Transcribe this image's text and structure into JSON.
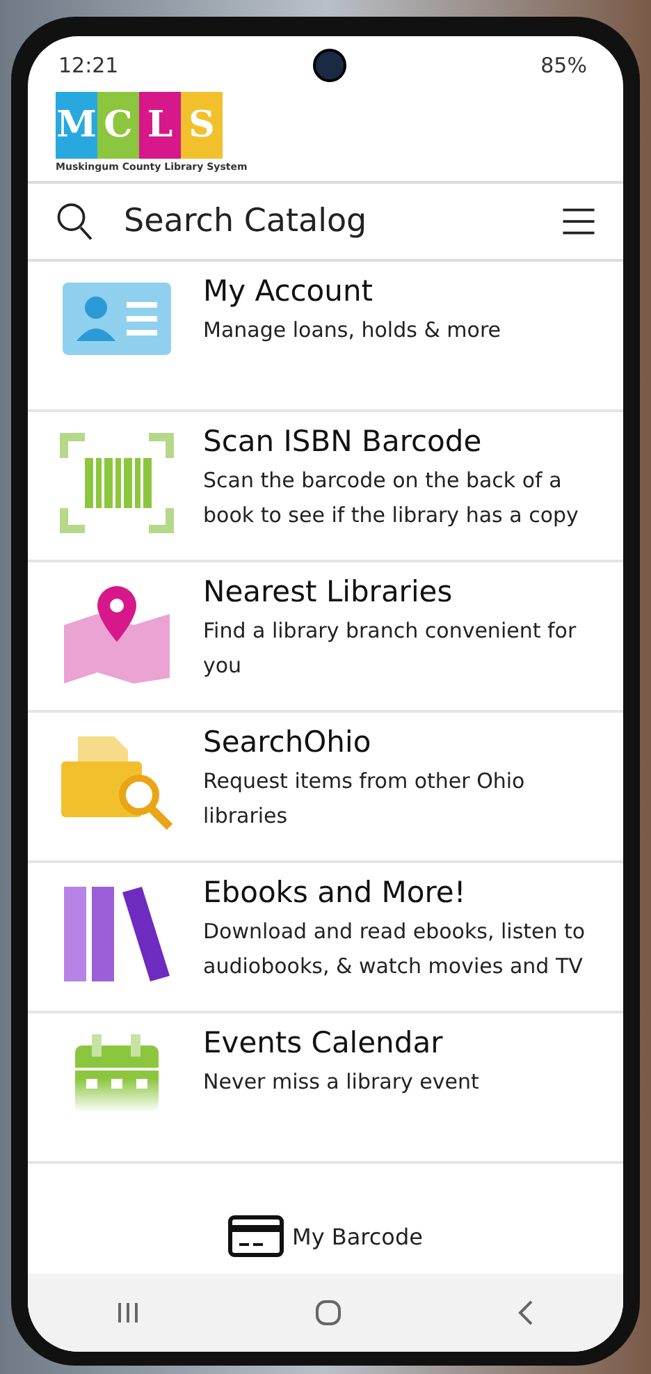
{
  "status_bar": {
    "time": "12:21",
    "battery": "85%"
  },
  "logo": {
    "letters": [
      {
        "text": "M",
        "color": "#29a8e0"
      },
      {
        "text": "C",
        "color": "#8cc63f"
      },
      {
        "text": "L",
        "color": "#d6188a"
      },
      {
        "text": "S",
        "color": "#f2c02c"
      }
    ],
    "tagline": "Muskingum County Library System"
  },
  "search": {
    "placeholder": "Search Catalog"
  },
  "menu_items": [
    {
      "kind": "account",
      "title": "My Account",
      "description": "Manage loans, holds & more"
    },
    {
      "kind": "barcode",
      "title": "Scan ISBN Barcode",
      "description": "Scan the barcode on the back of a book to see if the library has a copy"
    },
    {
      "kind": "map",
      "title": "Nearest Libraries",
      "description": "Find a library branch convenient for you"
    },
    {
      "kind": "search",
      "title": "SearchOhio",
      "description": "Request items from other Ohio libraries"
    },
    {
      "kind": "books",
      "title": "Ebooks and More!",
      "description": "Download and read ebooks, listen to audiobooks, & watch movies and TV"
    },
    {
      "kind": "calendar",
      "title": "Events Calendar",
      "description": "Never miss a library event"
    }
  ],
  "bottom_bar": {
    "label": "My Barcode"
  }
}
